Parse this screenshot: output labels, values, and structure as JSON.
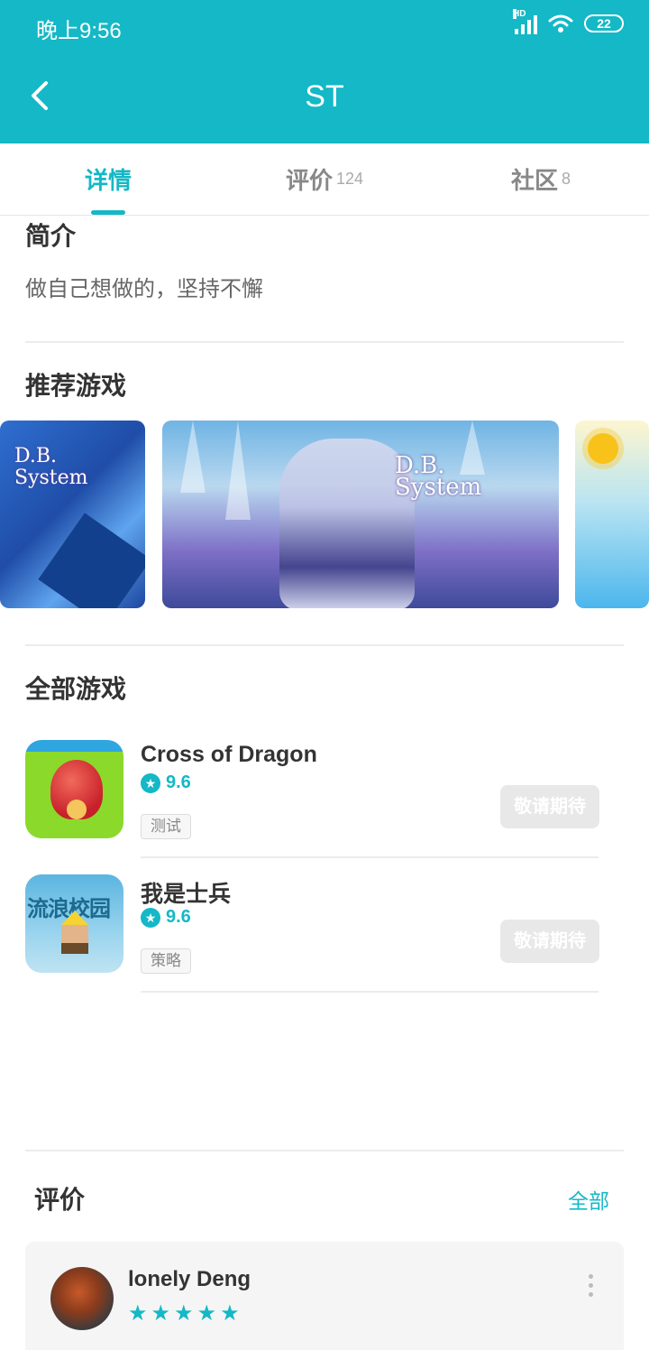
{
  "status_bar": {
    "time": "晚上9:56",
    "network": "HD",
    "battery": "22"
  },
  "header": {
    "title": "ST"
  },
  "tabs": [
    {
      "label": "详情",
      "count": ""
    },
    {
      "label": "评价",
      "count": "124"
    },
    {
      "label": "社区",
      "count": "8"
    }
  ],
  "intro": {
    "title": "简介",
    "text": "做自己想做的，坚持不懈"
  },
  "recommended": {
    "title": "推荐游戏",
    "banner_logo_line1": "D.B.",
    "banner_logo_line2": "System"
  },
  "all_games": {
    "title": "全部游戏",
    "items": [
      {
        "name": "Cross of Dragon",
        "rating": "9.6",
        "tag": "测试",
        "action": "敬请期待"
      },
      {
        "name": "我是士兵",
        "rating": "9.6",
        "tag": "策略",
        "action": "敬请期待",
        "icon_text": "流浪校园"
      }
    ]
  },
  "reviews": {
    "title": "评价",
    "all_label": "全部",
    "first": {
      "user": "lonely Deng",
      "stars": 5
    }
  },
  "colors": {
    "accent": "#14b8c6"
  }
}
